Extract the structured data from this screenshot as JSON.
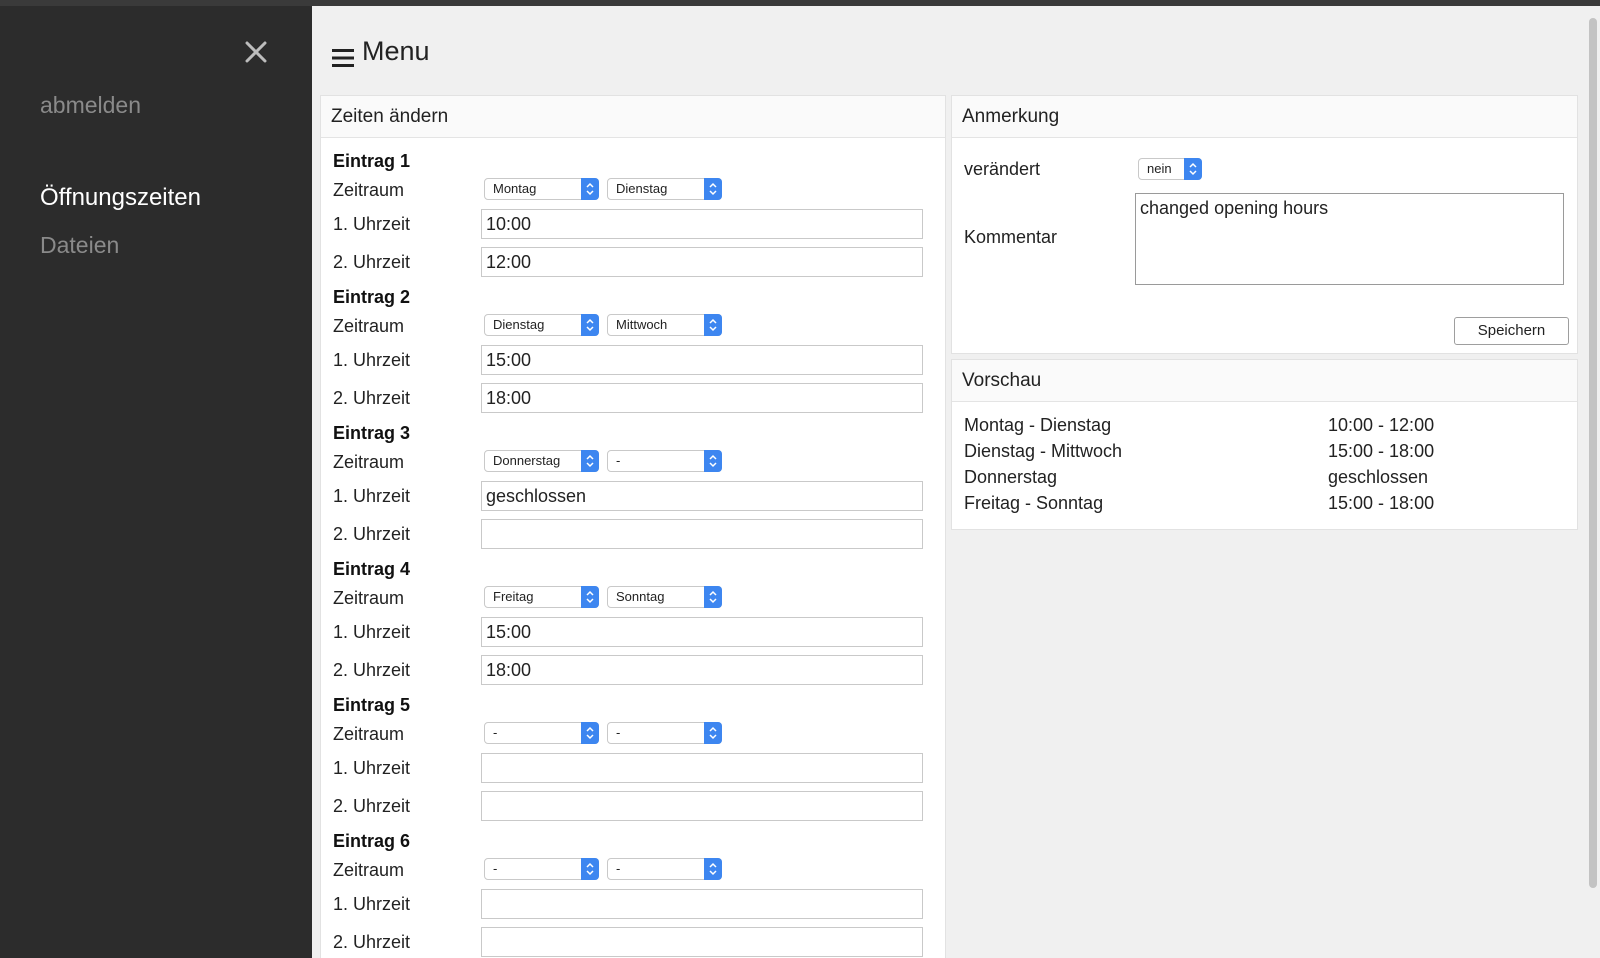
{
  "sidebar": {
    "close_icon": "close-icon",
    "logout": "abmelden",
    "nav": [
      {
        "label": "Öffnungszeiten",
        "active": true
      },
      {
        "label": "Dateien",
        "active": false
      }
    ]
  },
  "header": {
    "title": "Menu",
    "icon": "hamburger-icon"
  },
  "times_panel": {
    "title": "Zeiten ändern",
    "period_label": "Zeitraum",
    "time1_label": "1. Uhrzeit",
    "time2_label": "2. Uhrzeit",
    "entries": [
      {
        "title": "Eintrag 1",
        "from": "Montag",
        "to": "Dienstag",
        "time1": "10:00",
        "time2": "12:00"
      },
      {
        "title": "Eintrag 2",
        "from": "Dienstag",
        "to": "Mittwoch",
        "time1": "15:00",
        "time2": "18:00"
      },
      {
        "title": "Eintrag 3",
        "from": "Donnerstag",
        "to": "-",
        "time1": "geschlossen",
        "time2": ""
      },
      {
        "title": "Eintrag 4",
        "from": "Freitag",
        "to": "Sonntag",
        "time1": "15:00",
        "time2": "18:00"
      },
      {
        "title": "Eintrag 5",
        "from": "-",
        "to": "-",
        "time1": "",
        "time2": ""
      },
      {
        "title": "Eintrag 6",
        "from": "-",
        "to": "-",
        "time1": "",
        "time2": ""
      }
    ]
  },
  "note_panel": {
    "title": "Anmerkung",
    "changed_label": "verändert",
    "changed_value": "nein",
    "comment_label": "Kommentar",
    "comment_value": "changed opening hours",
    "save_label": "Speichern"
  },
  "preview_panel": {
    "title": "Vorschau",
    "rows": [
      {
        "days": "Montag - Dienstag",
        "hours": "10:00 - 12:00"
      },
      {
        "days": "Dienstag - Mittwoch",
        "hours": "15:00 - 18:00"
      },
      {
        "days": "Donnerstag",
        "hours": "geschlossen"
      },
      {
        "days": "Freitag - Sonntag",
        "hours": "15:00 - 18:00"
      }
    ]
  },
  "colors": {
    "sidebar_bg": "#2c2c2c",
    "main_bg": "#f0f0f0",
    "select_accent": "#3d86f0"
  }
}
